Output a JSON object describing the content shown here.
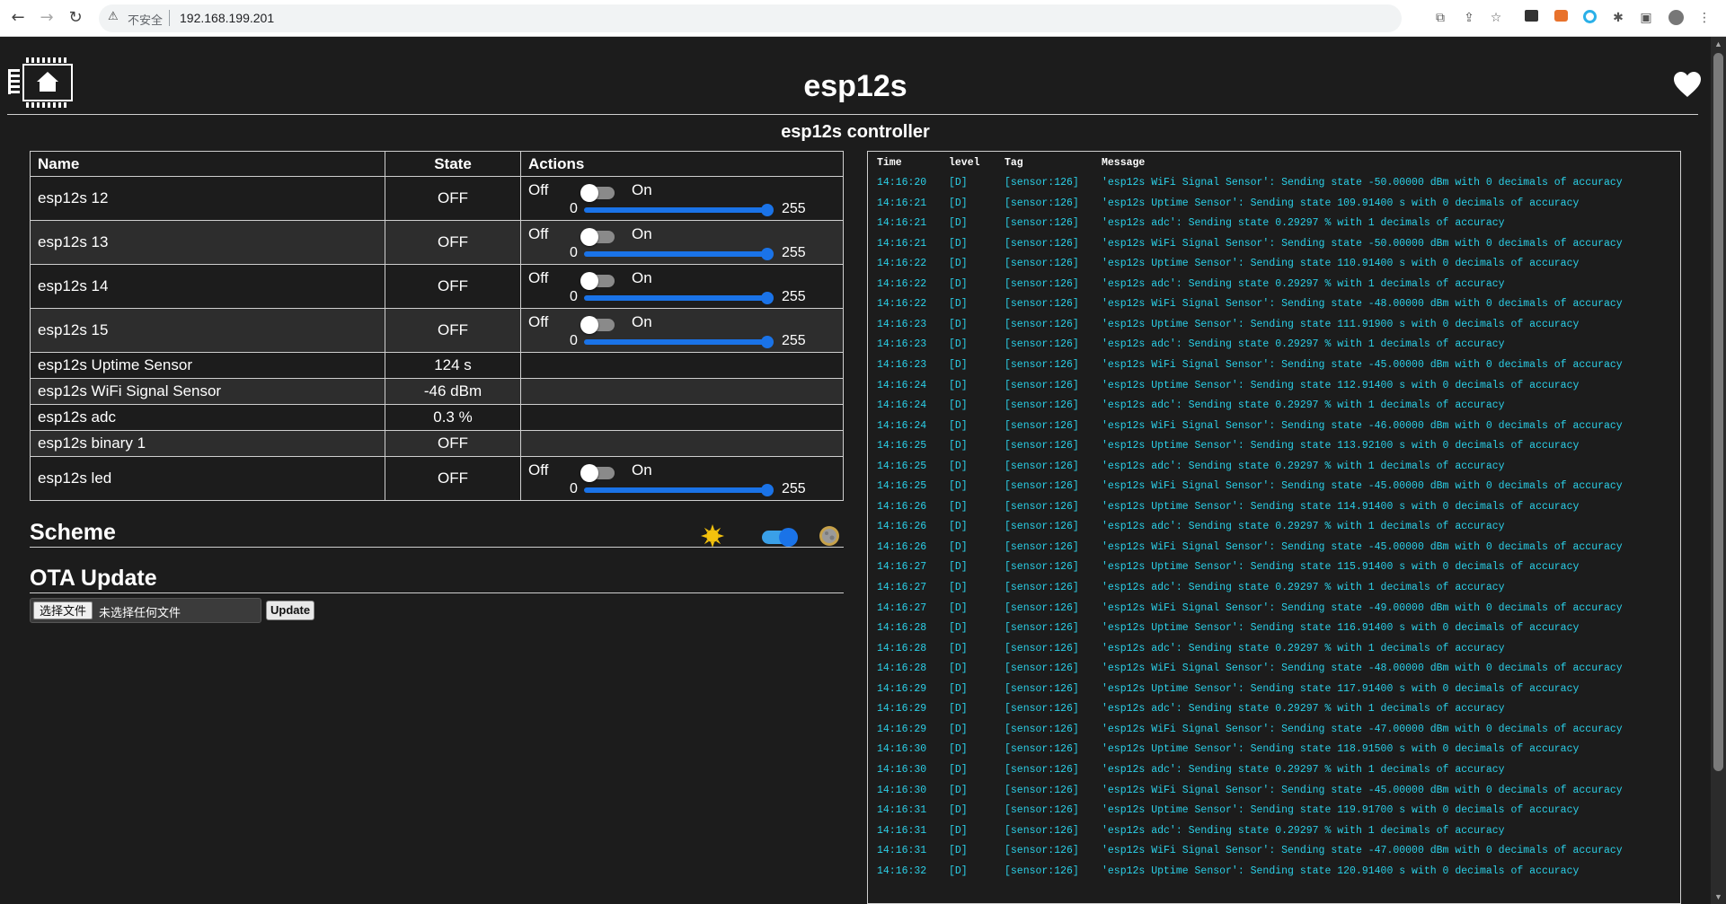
{
  "browser": {
    "security_label": "不安全",
    "url": "192.168.199.201"
  },
  "header": {
    "title": "esp12s",
    "subtitle": "esp12s controller"
  },
  "table": {
    "headers": {
      "name": "Name",
      "state": "State",
      "actions": "Actions"
    },
    "off_label": "Off",
    "on_label": "On",
    "range_min": "0",
    "range_max": "255",
    "rows": [
      {
        "name": "esp12s 12",
        "state": "OFF"
      },
      {
        "name": "esp12s 13",
        "state": "OFF"
      },
      {
        "name": "esp12s 14",
        "state": "OFF"
      },
      {
        "name": "esp12s 15",
        "state": "OFF"
      },
      {
        "name": "esp12s Uptime Sensor",
        "state": "124 s"
      },
      {
        "name": "esp12s WiFi Signal Sensor",
        "state": "-46 dBm"
      },
      {
        "name": "esp12s adc",
        "state": "0.3 %"
      },
      {
        "name": "esp12s binary 1",
        "state": "OFF"
      },
      {
        "name": "esp12s led",
        "state": "OFF"
      }
    ]
  },
  "scheme": {
    "title": "Scheme"
  },
  "ota": {
    "title": "OTA Update",
    "choose_file": "选择文件",
    "no_file": "未选择任何文件",
    "update_button": "Update"
  },
  "log": {
    "headers": {
      "time": "Time",
      "level": "level",
      "tag": "Tag",
      "message": "Message"
    },
    "entries": [
      {
        "time": "14:16:20",
        "level": "[D]",
        "tag": "[sensor:126]",
        "message": "'esp12s WiFi Signal Sensor': Sending state -50.00000 dBm with 0 decimals of accuracy"
      },
      {
        "time": "14:16:21",
        "level": "[D]",
        "tag": "[sensor:126]",
        "message": "'esp12s Uptime Sensor': Sending state 109.91400 s with 0 decimals of accuracy"
      },
      {
        "time": "14:16:21",
        "level": "[D]",
        "tag": "[sensor:126]",
        "message": "'esp12s adc': Sending state 0.29297 % with 1 decimals of accuracy"
      },
      {
        "time": "14:16:21",
        "level": "[D]",
        "tag": "[sensor:126]",
        "message": "'esp12s WiFi Signal Sensor': Sending state -50.00000 dBm with 0 decimals of accuracy"
      },
      {
        "time": "14:16:22",
        "level": "[D]",
        "tag": "[sensor:126]",
        "message": "'esp12s Uptime Sensor': Sending state 110.91400 s with 0 decimals of accuracy"
      },
      {
        "time": "14:16:22",
        "level": "[D]",
        "tag": "[sensor:126]",
        "message": "'esp12s adc': Sending state 0.29297 % with 1 decimals of accuracy"
      },
      {
        "time": "14:16:22",
        "level": "[D]",
        "tag": "[sensor:126]",
        "message": "'esp12s WiFi Signal Sensor': Sending state -48.00000 dBm with 0 decimals of accuracy"
      },
      {
        "time": "14:16:23",
        "level": "[D]",
        "tag": "[sensor:126]",
        "message": "'esp12s Uptime Sensor': Sending state 111.91900 s with 0 decimals of accuracy"
      },
      {
        "time": "14:16:23",
        "level": "[D]",
        "tag": "[sensor:126]",
        "message": "'esp12s adc': Sending state 0.29297 % with 1 decimals of accuracy"
      },
      {
        "time": "14:16:23",
        "level": "[D]",
        "tag": "[sensor:126]",
        "message": "'esp12s WiFi Signal Sensor': Sending state -45.00000 dBm with 0 decimals of accuracy"
      },
      {
        "time": "14:16:24",
        "level": "[D]",
        "tag": "[sensor:126]",
        "message": "'esp12s Uptime Sensor': Sending state 112.91400 s with 0 decimals of accuracy"
      },
      {
        "time": "14:16:24",
        "level": "[D]",
        "tag": "[sensor:126]",
        "message": "'esp12s adc': Sending state 0.29297 % with 1 decimals of accuracy"
      },
      {
        "time": "14:16:24",
        "level": "[D]",
        "tag": "[sensor:126]",
        "message": "'esp12s WiFi Signal Sensor': Sending state -46.00000 dBm with 0 decimals of accuracy"
      },
      {
        "time": "14:16:25",
        "level": "[D]",
        "tag": "[sensor:126]",
        "message": "'esp12s Uptime Sensor': Sending state 113.92100 s with 0 decimals of accuracy"
      },
      {
        "time": "14:16:25",
        "level": "[D]",
        "tag": "[sensor:126]",
        "message": "'esp12s adc': Sending state 0.29297 % with 1 decimals of accuracy"
      },
      {
        "time": "14:16:25",
        "level": "[D]",
        "tag": "[sensor:126]",
        "message": "'esp12s WiFi Signal Sensor': Sending state -45.00000 dBm with 0 decimals of accuracy"
      },
      {
        "time": "14:16:26",
        "level": "[D]",
        "tag": "[sensor:126]",
        "message": "'esp12s Uptime Sensor': Sending state 114.91400 s with 0 decimals of accuracy"
      },
      {
        "time": "14:16:26",
        "level": "[D]",
        "tag": "[sensor:126]",
        "message": "'esp12s adc': Sending state 0.29297 % with 1 decimals of accuracy"
      },
      {
        "time": "14:16:26",
        "level": "[D]",
        "tag": "[sensor:126]",
        "message": "'esp12s WiFi Signal Sensor': Sending state -45.00000 dBm with 0 decimals of accuracy"
      },
      {
        "time": "14:16:27",
        "level": "[D]",
        "tag": "[sensor:126]",
        "message": "'esp12s Uptime Sensor': Sending state 115.91400 s with 0 decimals of accuracy"
      },
      {
        "time": "14:16:27",
        "level": "[D]",
        "tag": "[sensor:126]",
        "message": "'esp12s adc': Sending state 0.29297 % with 1 decimals of accuracy"
      },
      {
        "time": "14:16:27",
        "level": "[D]",
        "tag": "[sensor:126]",
        "message": "'esp12s WiFi Signal Sensor': Sending state -49.00000 dBm with 0 decimals of accuracy"
      },
      {
        "time": "14:16:28",
        "level": "[D]",
        "tag": "[sensor:126]",
        "message": "'esp12s Uptime Sensor': Sending state 116.91400 s with 0 decimals of accuracy"
      },
      {
        "time": "14:16:28",
        "level": "[D]",
        "tag": "[sensor:126]",
        "message": "'esp12s adc': Sending state 0.29297 % with 1 decimals of accuracy"
      },
      {
        "time": "14:16:28",
        "level": "[D]",
        "tag": "[sensor:126]",
        "message": "'esp12s WiFi Signal Sensor': Sending state -48.00000 dBm with 0 decimals of accuracy"
      },
      {
        "time": "14:16:29",
        "level": "[D]",
        "tag": "[sensor:126]",
        "message": "'esp12s Uptime Sensor': Sending state 117.91400 s with 0 decimals of accuracy"
      },
      {
        "time": "14:16:29",
        "level": "[D]",
        "tag": "[sensor:126]",
        "message": "'esp12s adc': Sending state 0.29297 % with 1 decimals of accuracy"
      },
      {
        "time": "14:16:29",
        "level": "[D]",
        "tag": "[sensor:126]",
        "message": "'esp12s WiFi Signal Sensor': Sending state -47.00000 dBm with 0 decimals of accuracy"
      },
      {
        "time": "14:16:30",
        "level": "[D]",
        "tag": "[sensor:126]",
        "message": "'esp12s Uptime Sensor': Sending state 118.91500 s with 0 decimals of accuracy"
      },
      {
        "time": "14:16:30",
        "level": "[D]",
        "tag": "[sensor:126]",
        "message": "'esp12s adc': Sending state 0.29297 % with 1 decimals of accuracy"
      },
      {
        "time": "14:16:30",
        "level": "[D]",
        "tag": "[sensor:126]",
        "message": "'esp12s WiFi Signal Sensor': Sending state -45.00000 dBm with 0 decimals of accuracy"
      },
      {
        "time": "14:16:31",
        "level": "[D]",
        "tag": "[sensor:126]",
        "message": "'esp12s Uptime Sensor': Sending state 119.91700 s with 0 decimals of accuracy"
      },
      {
        "time": "14:16:31",
        "level": "[D]",
        "tag": "[sensor:126]",
        "message": "'esp12s adc': Sending state 0.29297 % with 1 decimals of accuracy"
      },
      {
        "time": "14:16:31",
        "level": "[D]",
        "tag": "[sensor:126]",
        "message": "'esp12s WiFi Signal Sensor': Sending state -47.00000 dBm with 0 decimals of accuracy"
      },
      {
        "time": "14:16:32",
        "level": "[D]",
        "tag": "[sensor:126]",
        "message": "'esp12s Uptime Sensor': Sending state 120.91400 s with 0 decimals of accuracy"
      }
    ]
  },
  "colors": {
    "background": "#1c1c1c",
    "log_text": "#2bd0e8",
    "accent": "#1a73e8"
  }
}
